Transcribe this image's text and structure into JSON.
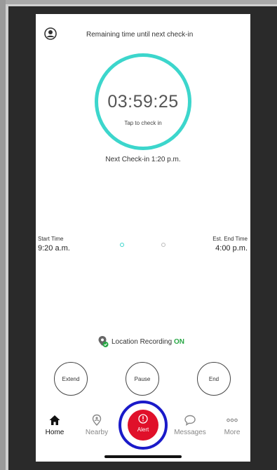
{
  "header": {
    "profile_icon": "account-circle-icon",
    "title": "Remaining time until next check-in"
  },
  "timer": {
    "value": "03:59:25",
    "tap_label": "Tap to check in",
    "ring_color": "#3cd6cc"
  },
  "next_checkin": "Next Check-in 1:20 p.m.",
  "schedule": {
    "start_label": "Start Time",
    "start_value": "9:20 a.m.",
    "end_label": "Est. End Time",
    "end_value": "4:00 p.m."
  },
  "location": {
    "icon": "location-check-icon",
    "label": "Location Recording",
    "status": "ON",
    "status_color": "#28a745"
  },
  "actions": {
    "extend": "Extend",
    "pause": "Pause",
    "end": "End"
  },
  "nav": {
    "home": "Home",
    "nearby": "Nearby",
    "alert": "Alert",
    "messages": "Messages",
    "more": "More",
    "alert_color": "#e0102a",
    "highlight_color": "#1a1ac9"
  }
}
